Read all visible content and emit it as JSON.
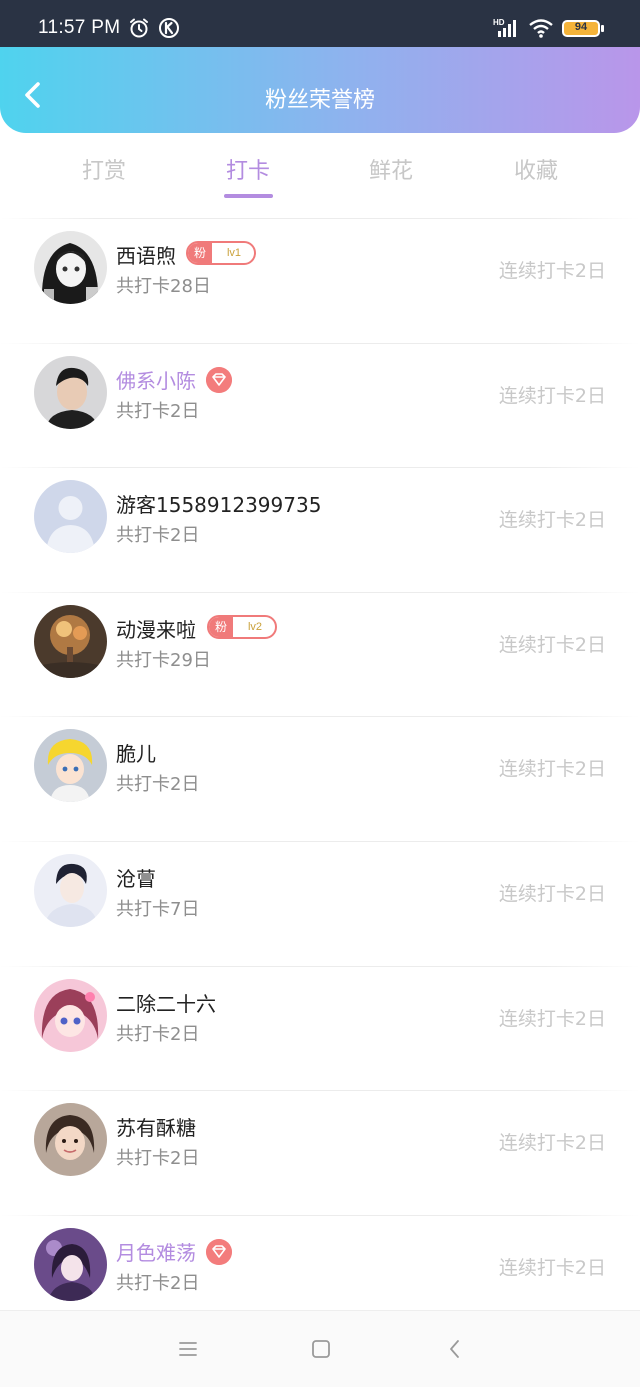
{
  "status_bar": {
    "time": "11:57 PM",
    "battery": "94"
  },
  "header": {
    "title": "粉丝荣誉榜"
  },
  "tabs": [
    {
      "label": "打赏",
      "active": false
    },
    {
      "label": "打卡",
      "active": true
    },
    {
      "label": "鲜花",
      "active": false
    },
    {
      "label": "收藏",
      "active": false
    }
  ],
  "colors": {
    "accent": "#b38ce0",
    "badge": "#f07a7a",
    "header_from": "#4fd3ee",
    "header_to": "#b996ea"
  },
  "users": [
    {
      "name": "西语煦",
      "total": "共打卡28日",
      "streak": "连续打卡2日",
      "badge": "fan",
      "fan_label": "粉",
      "fan_level": "lv1",
      "name_color": "default"
    },
    {
      "name": "佛系小陈",
      "total": "共打卡2日",
      "streak": "连续打卡2日",
      "badge": "vip",
      "name_color": "purple"
    },
    {
      "name": "游客1558912399735",
      "total": "共打卡2日",
      "streak": "连续打卡2日",
      "badge": "none",
      "name_color": "default"
    },
    {
      "name": "动漫来啦",
      "total": "共打卡29日",
      "streak": "连续打卡2日",
      "badge": "fan",
      "fan_label": "粉",
      "fan_level": "lv2",
      "name_color": "default"
    },
    {
      "name": "脆儿",
      "total": "共打卡2日",
      "streak": "连续打卡2日",
      "badge": "none",
      "name_color": "default"
    },
    {
      "name": "沧萺",
      "total": "共打卡7日",
      "streak": "连续打卡2日",
      "badge": "none",
      "name_color": "default"
    },
    {
      "name": "二除二十六",
      "total": "共打卡2日",
      "streak": "连续打卡2日",
      "badge": "none",
      "name_color": "default"
    },
    {
      "name": "苏有酥糖",
      "total": "共打卡2日",
      "streak": "连续打卡2日",
      "badge": "none",
      "name_color": "default"
    },
    {
      "name": "月色难荡",
      "total": "共打卡2日",
      "streak": "连续打卡2日",
      "badge": "vip",
      "name_color": "purple"
    }
  ],
  "nav": {
    "icons": [
      "menu-icon",
      "home-square-icon",
      "back-chevron-icon"
    ]
  }
}
